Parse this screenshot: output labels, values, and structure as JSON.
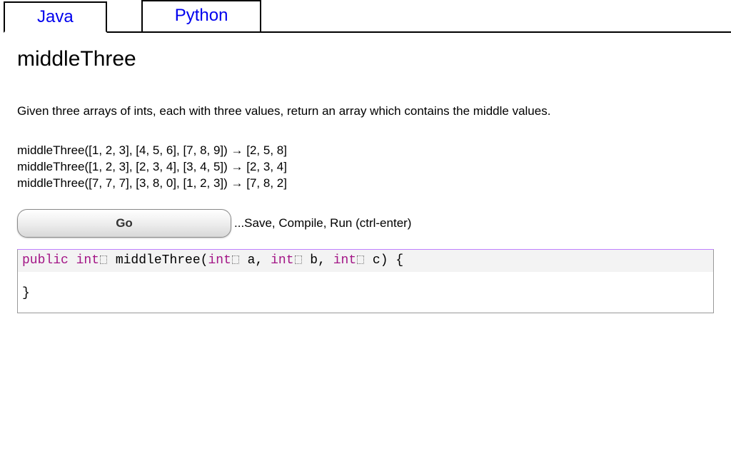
{
  "tabs": {
    "java": "Java",
    "python": "Python"
  },
  "problem": {
    "title": "middleThree",
    "description": "Given three arrays of ints, each with three values, return an array which contains the middle values.",
    "examples": [
      "middleThree([1, 2, 3], [4, 5, 6], [7, 8, 9]) → [2, 5, 8]",
      "middleThree([1, 2, 3], [2, 3, 4], [3, 4, 5]) → [2, 3, 4]",
      "middleThree([7, 7, 7], [3, 8, 0], [1, 2, 3]) → [7, 8, 2]"
    ]
  },
  "controls": {
    "go_label": "Go",
    "hint": "...Save, Compile, Run (ctrl-enter)"
  },
  "code": {
    "kw_public": "public",
    "kw_int1": "int",
    "fn_name": " middleThree(",
    "kw_int2": "int",
    "param_a": " a, ",
    "kw_int3": "int",
    "param_b": " b, ",
    "kw_int4": "int",
    "param_c": " c) {",
    "close_brace": "}"
  }
}
